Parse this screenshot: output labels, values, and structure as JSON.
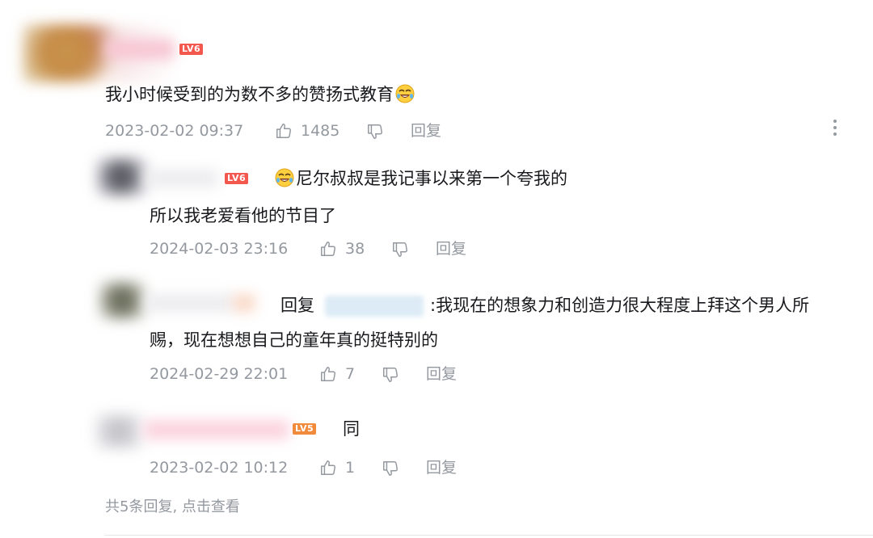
{
  "main_comment": {
    "level": "LV6",
    "content": "我小时候受到的为数不多的赞扬式教育",
    "emoji": "laugh-cry-emoji",
    "time": "2023-02-02 09:37",
    "likes": "1485",
    "reply_label": "回复"
  },
  "replies": [
    {
      "level": "LV6",
      "emoji": "laugh-cry-emoji",
      "content_line1": "尼尔叔叔是我记事以来第一个夸我的",
      "content_line2": "所以我老爱看他的节目了",
      "time": "2024-02-03 23:16",
      "likes": "38",
      "reply_label": "回复"
    },
    {
      "reply_prefix": "回复",
      "content_line1": ":我现在的想象力和创造力很大程度上拜这个男人所",
      "content_line2": "赐，现在想想自己的童年真的挺特别的",
      "time": "2024-02-29 22:01",
      "likes": "7",
      "reply_label": "回复"
    },
    {
      "level": "LV5",
      "content": "同",
      "time": "2023-02-02 10:12",
      "likes": "1",
      "reply_label": "回复"
    }
  ],
  "view_more": "共5条回复, 点击查看",
  "colors": {
    "text": "#18191c",
    "meta": "#9499a0",
    "lv6": "#f2584e",
    "lv5": "#f28a3c"
  }
}
